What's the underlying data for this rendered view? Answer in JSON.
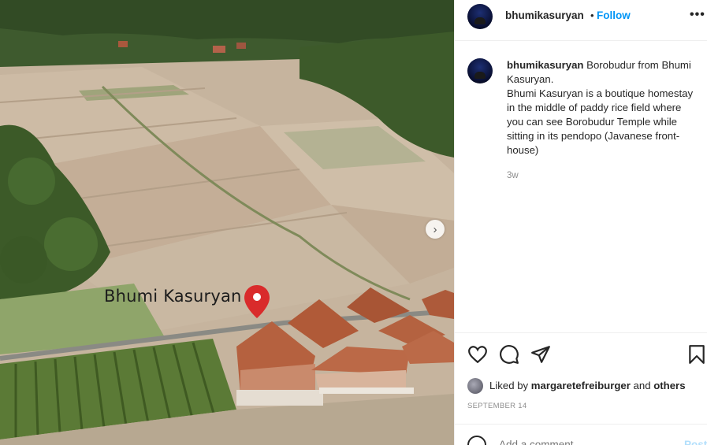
{
  "post": {
    "image_overlay_label": "Bhumi Kasuryan",
    "next_icon": "chevron-right-icon"
  },
  "header": {
    "username": "bhumikasuryan",
    "separator": "•",
    "follow_label": "Follow",
    "more_icon": "more-horizontal-icon",
    "more_label": "•••"
  },
  "caption": {
    "username": "bhumikasuryan",
    "text": "Borobudur from Bhumi Kasuryan.\nBhumi Kasuryan is a boutique homestay in the middle of paddy rice field where you can see Borobudur Temple while sitting in its pendopo (Javanese front-house)",
    "time": "3w"
  },
  "actions": {
    "like_icon": "heart-icon",
    "comment_icon": "comment-icon",
    "share_icon": "send-icon",
    "save_icon": "bookmark-icon"
  },
  "likes": {
    "prefix": "Liked by",
    "user": "margaretefreiburger",
    "conjunction": "and",
    "others": "others"
  },
  "date": "SEPTEMBER 14",
  "comment": {
    "emoji_icon": "emoji-icon",
    "placeholder": "Add a comment...",
    "post_label": "Post"
  },
  "colors": {
    "accent": "#0095f6",
    "post_disabled": "#b2dffc",
    "pin": "#d92b2b"
  }
}
